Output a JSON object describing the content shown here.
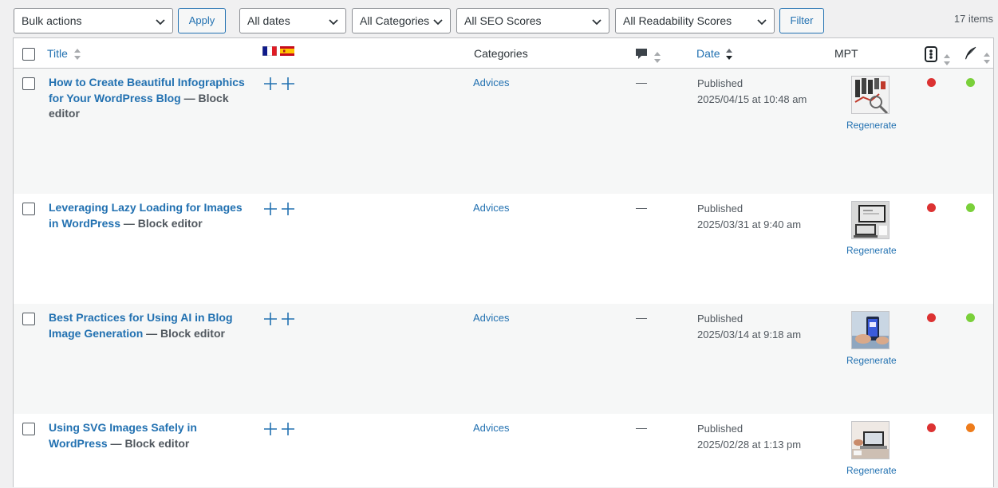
{
  "toolbar": {
    "bulk_actions": "Bulk actions",
    "apply": "Apply",
    "dates": "All dates",
    "categories": "All Categories",
    "seo": "All SEO Scores",
    "readability": "All Readability Scores",
    "filter": "Filter",
    "items_count": "17 items"
  },
  "columns": {
    "title": "Title",
    "categories": "Categories",
    "date": "Date",
    "mpt": "MPT"
  },
  "flags": [
    "flag-france-icon",
    "flag-spain-icon"
  ],
  "colors": {
    "link": "#2271b1",
    "seo_bad": "#dc3232",
    "readability_good": "#7ad03a",
    "readability_ok": "#ee7c1b"
  },
  "posts": [
    {
      "title": "How to Create Beautiful Infographics for Your WordPress Blog",
      "state": " — Block editor",
      "category": "Advices",
      "comments": "—",
      "status": "Published",
      "date": "2025/04/15 at 10:48 am",
      "regenerate": "Regenerate",
      "seo_color": "#dc3232",
      "readability_color": "#7ad03a"
    },
    {
      "title": "Leveraging Lazy Loading for Images in WordPress",
      "state": " — Block editor",
      "category": "Advices",
      "comments": "—",
      "status": "Published",
      "date": "2025/03/31 at 9:40 am",
      "regenerate": "Regenerate",
      "seo_color": "#dc3232",
      "readability_color": "#7ad03a"
    },
    {
      "title": "Best Practices for Using AI in Blog Image Generation",
      "state": " — Block editor",
      "category": "Advices",
      "comments": "—",
      "status": "Published",
      "date": "2025/03/14 at 9:18 am",
      "regenerate": "Regenerate",
      "seo_color": "#dc3232",
      "readability_color": "#7ad03a"
    },
    {
      "title": "Using SVG Images Safely in WordPress",
      "state": " — Block editor",
      "category": "Advices",
      "comments": "—",
      "status": "Published",
      "date": "2025/02/28 at 1:13 pm",
      "regenerate": "Regenerate",
      "seo_color": "#dc3232",
      "readability_color": "#ee7c1b"
    }
  ]
}
